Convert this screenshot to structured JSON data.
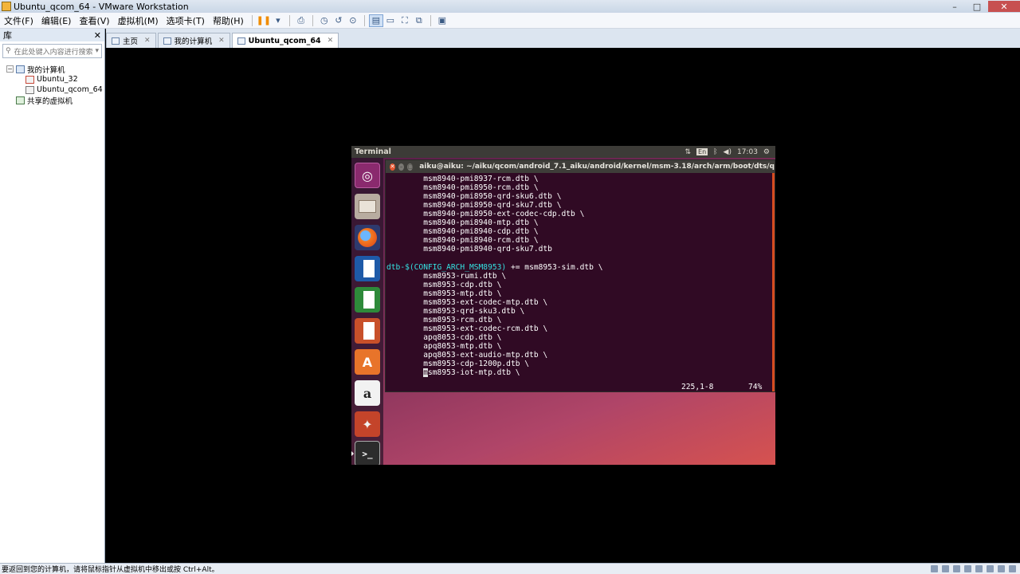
{
  "window": {
    "title": "Ubuntu_qcom_64 - VMware Workstation",
    "controls": [
      "–",
      "□",
      "✕"
    ]
  },
  "menubar": {
    "items": [
      "文件(F)",
      "编辑(E)",
      "查看(V)",
      "虚拟机(M)",
      "选项卡(T)",
      "帮助(H)"
    ],
    "pause_dropdown": "▾"
  },
  "library": {
    "title": "库",
    "close": "✕",
    "search_placeholder": "在此处键入内容进行搜索",
    "dropdown": "▾",
    "tree": {
      "root_toggle": "−",
      "root": "我的计算机",
      "vms": [
        "Ubuntu_32",
        "Ubuntu_qcom_64"
      ],
      "shared": "共享的虚拟机"
    }
  },
  "tabs": [
    {
      "label": "主页",
      "close": "✕"
    },
    {
      "label": "我的计算机",
      "close": "✕"
    },
    {
      "label": "Ubuntu_qcom_64",
      "close": "✕"
    }
  ],
  "ubuntu": {
    "panel": {
      "title": "Terminal",
      "sort_indicator": "⇅",
      "keyboard": "En",
      "bluetooth": "ᛒ",
      "volume": "◀)",
      "time": "17:03",
      "gear": "⚙"
    },
    "launcher": {
      "dash": "◎",
      "amazon": "a",
      "settings": "✦",
      "terminal": ">_"
    },
    "terminal": {
      "buttons": {
        "close": "✕",
        "min": "–",
        "max": "▢"
      },
      "title": "aiku@aiku: ~/aiku/qcom/android_7.1_aiku/android/kernel/msm-3.18/arch/arm/boot/dts/q",
      "lines_a": [
        "        msm8940-pmi8937-rcm.dtb \\",
        "        msm8940-pmi8950-rcm.dtb \\",
        "        msm8940-pmi8950-qrd-sku6.dtb \\",
        "        msm8940-pmi8950-qrd-sku7.dtb \\",
        "        msm8940-pmi8950-ext-codec-cdp.dtb \\",
        "        msm8940-pmi8940-mtp.dtb \\",
        "        msm8940-pmi8940-cdp.dtb \\",
        "        msm8940-pmi8940-rcm.dtb \\",
        "        msm8940-pmi8940-qrd-sku7.dtb"
      ],
      "dtb_var": "dtb-$(CONFIG_ARCH_MSM8953)",
      "dtb_rest": " += msm8953-sim.dtb \\",
      "lines_b": [
        "        msm8953-rumi.dtb \\",
        "        msm8953-cdp.dtb \\",
        "        msm8953-mtp.dtb \\",
        "        msm8953-ext-codec-mtp.dtb \\",
        "        msm8953-qrd-sku3.dtb \\",
        "        msm8953-rcm.dtb \\",
        "        msm8953-ext-codec-rcm.dtb \\",
        "        apq8053-cdp.dtb \\",
        "        apq8053-mtp.dtb \\",
        "        apq8053-ext-audio-mtp.dtb \\",
        "        msm8953-cdp-1200p.dtb \\"
      ],
      "last_line_indent": "        ",
      "last_line_cursor": "m",
      "last_line_rest": "sm8953-iot-mtp.dtb \\",
      "vim_position": "225,1-8",
      "vim_percent": "74%"
    }
  },
  "statusbar": {
    "message": "要返回到您的计算机，请将鼠标指针从虚拟机中移出或按 Ctrl+Alt。"
  }
}
